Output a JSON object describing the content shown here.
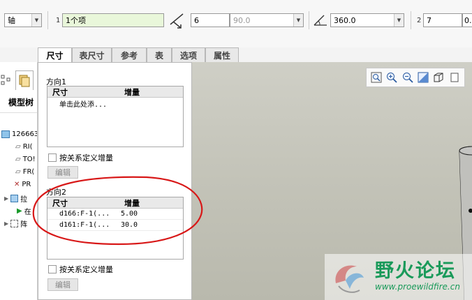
{
  "toolbar": {
    "axis_select": "轴",
    "dir1_num": "1",
    "dir1_field": "1个项",
    "dim1_value": "6",
    "dim1_combo": "90.0",
    "angle_value": "360.0",
    "dir2_num": "2",
    "dim2_value": "7",
    "dim2_cut": "0."
  },
  "tabs": [
    "尺寸",
    "表尺寸",
    "参考",
    "表",
    "选项",
    "属性"
  ],
  "tree": {
    "header": "模型树",
    "items": [
      "126663",
      "RI(",
      "TO!",
      "FR(",
      "PR",
      "拉",
      "在",
      "阵"
    ]
  },
  "panel": {
    "dir1": {
      "title": "方向1",
      "col_dim": "尺寸",
      "col_inc": "增量",
      "placeholder": "单击此处添...",
      "checkbox": "按关系定义增量",
      "edit": "编辑"
    },
    "dir2": {
      "title": "方向2",
      "col_dim": "尺寸",
      "col_inc": "增量",
      "rows": [
        {
          "dim": "d166:F-1(...",
          "inc": "5.00"
        },
        {
          "dim": "d161:F-1(...",
          "inc": "30.0"
        }
      ],
      "checkbox": "按关系定义增量",
      "edit": "编辑"
    }
  },
  "watermark": {
    "title": "野火论坛",
    "url": "www.proewildfire.cn"
  },
  "colors": {
    "annotation": "#d81818",
    "field_green": "#e9f7da",
    "watermark": "#1a9a5a"
  }
}
